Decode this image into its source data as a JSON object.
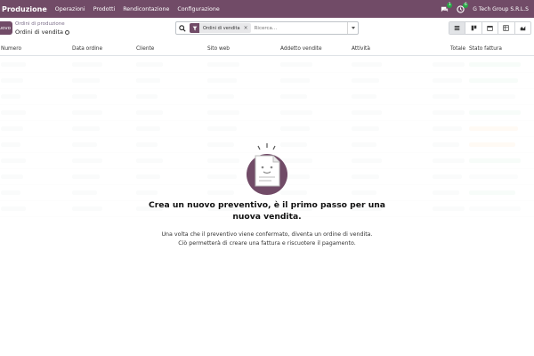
{
  "navbar": {
    "brand": "Produzione",
    "menu": [
      "Operazioni",
      "Prodotti",
      "Rendicontazione",
      "Configurazione"
    ],
    "badges": {
      "messages": "1",
      "activities": "6"
    },
    "company": "G Tech Group S.R.L.S"
  },
  "control_panel": {
    "new_button": "Nuovo",
    "breadcrumb_parent": "Ordini di produzione",
    "breadcrumb_current": "Ordini di vendita",
    "search": {
      "facet": "Ordini di vendita",
      "placeholder": "Ricerca..."
    }
  },
  "table": {
    "columns": [
      "Numero",
      "Data ordine",
      "Cliente",
      "Sito web",
      "Addetto vendite",
      "Attività",
      "Totale",
      "Stato fattura"
    ]
  },
  "helper": {
    "title": "Crea un nuovo preventivo, è il primo passo per una nuova vendita.",
    "line1": "Una volta che il preventivo viene confermato, diventa un ordine di vendita.",
    "line2": "Ciò permetterà di creare una fattura e riscuotere il pagamento."
  },
  "colors": {
    "brand": "#714b67",
    "badge": "#28a745"
  }
}
